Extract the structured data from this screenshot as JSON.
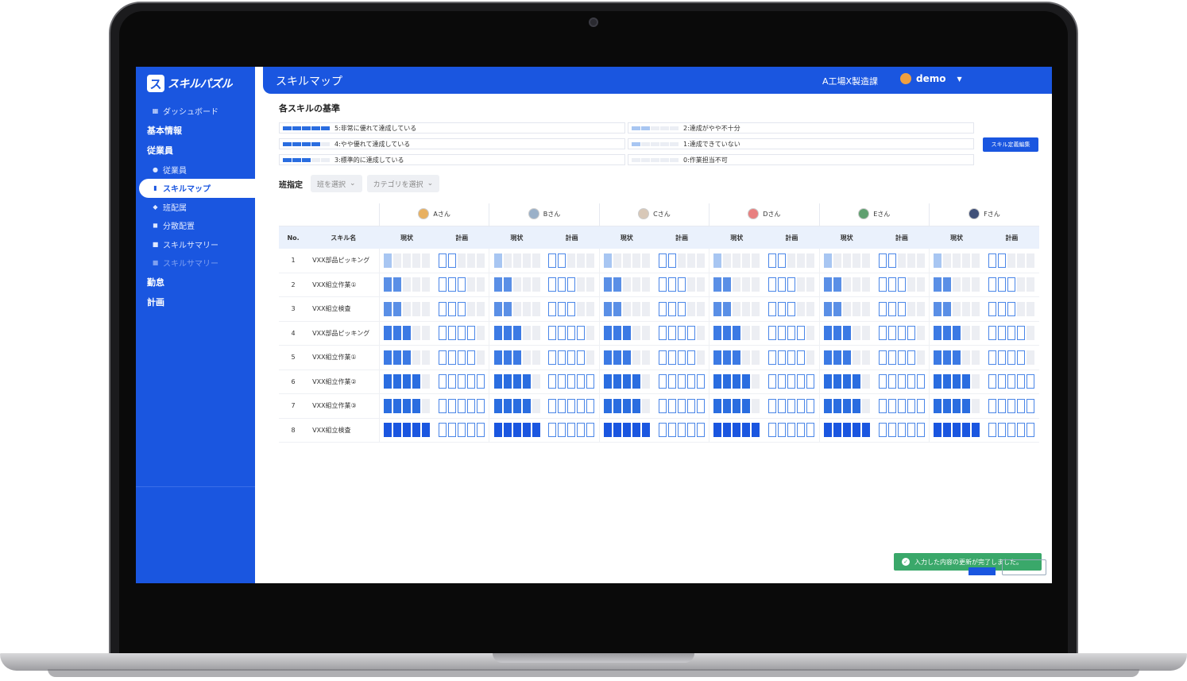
{
  "app": {
    "logo_text": "スキルパズル",
    "page_title": "スキルマップ",
    "factory": "A工場X製造課",
    "user": "demo"
  },
  "sidebar": {
    "items": [
      {
        "type": "item",
        "label": "ダッシュボード",
        "icon": "dashboard-icon"
      },
      {
        "type": "section",
        "label": "基本情報"
      },
      {
        "type": "section",
        "label": "従業員"
      },
      {
        "type": "item",
        "label": "従業員",
        "icon": "person-icon"
      },
      {
        "type": "item",
        "label": "スキルマップ",
        "icon": "map-icon",
        "active": true
      },
      {
        "type": "item",
        "label": "班配属",
        "icon": "group-icon"
      },
      {
        "type": "item",
        "label": "分散配置",
        "icon": "distribute-icon"
      },
      {
        "type": "item",
        "label": "スキルサマリー",
        "icon": "summary-icon"
      },
      {
        "type": "item",
        "label": "スキルサマリー",
        "icon": "summary-icon",
        "dim": true
      },
      {
        "type": "section",
        "label": "勤怠"
      },
      {
        "type": "section",
        "label": "計画"
      }
    ]
  },
  "criteria": {
    "title": "各スキルの基準",
    "items": [
      {
        "level": 5,
        "label": "5:非常に優れて達成している"
      },
      {
        "level": 4,
        "label": "4:やや優れて達成している"
      },
      {
        "level": 3,
        "label": "3:標準的に達成している"
      },
      {
        "level": 2,
        "label": "2:達成がやや不十分"
      },
      {
        "level": 1,
        "label": "1:達成できていない"
      },
      {
        "level": 0,
        "label": "0:作業担当不可"
      }
    ],
    "edit_button": "スキル定義編集"
  },
  "filters": {
    "label": "班指定",
    "team_placeholder": "班を選択",
    "category_placeholder": "カテゴリを選択"
  },
  "table": {
    "col_no": "No.",
    "col_skill": "スキル名",
    "col_current": "現状",
    "col_plan": "計画",
    "employees": [
      {
        "name": "Aさん",
        "color": "#e8b060"
      },
      {
        "name": "Bさん",
        "color": "#9ab0c8"
      },
      {
        "name": "Cさん",
        "color": "#d8c8b8"
      },
      {
        "name": "Dさん",
        "color": "#e88080"
      },
      {
        "name": "Eさん",
        "color": "#60a070"
      },
      {
        "name": "Fさん",
        "color": "#405078"
      }
    ],
    "rows": [
      {
        "no": "1",
        "skill": "VXX部品ピッキング",
        "current": 1,
        "plan": 2
      },
      {
        "no": "2",
        "skill": "VXX組立作業①",
        "current": 2,
        "plan": 3
      },
      {
        "no": "3",
        "skill": "VXX組立検査",
        "current": 2,
        "plan": 3
      },
      {
        "no": "4",
        "skill": "VXX部品ピッキング",
        "current": 3,
        "plan": 4
      },
      {
        "no": "5",
        "skill": "VXX組立作業①",
        "current": 3,
        "plan": 4
      },
      {
        "no": "6",
        "skill": "VXX組立作業②",
        "current": 4,
        "plan": 5
      },
      {
        "no": "7",
        "skill": "VXX組立作業③",
        "current": 4,
        "plan": 5
      },
      {
        "no": "8",
        "skill": "VXX組立検査",
        "current": 5,
        "plan": 5
      }
    ]
  },
  "toast": {
    "message": "入力した内容の更新が完了しました。"
  },
  "colors": {
    "brand": "#1a56e0",
    "success": "#3aa86a"
  }
}
